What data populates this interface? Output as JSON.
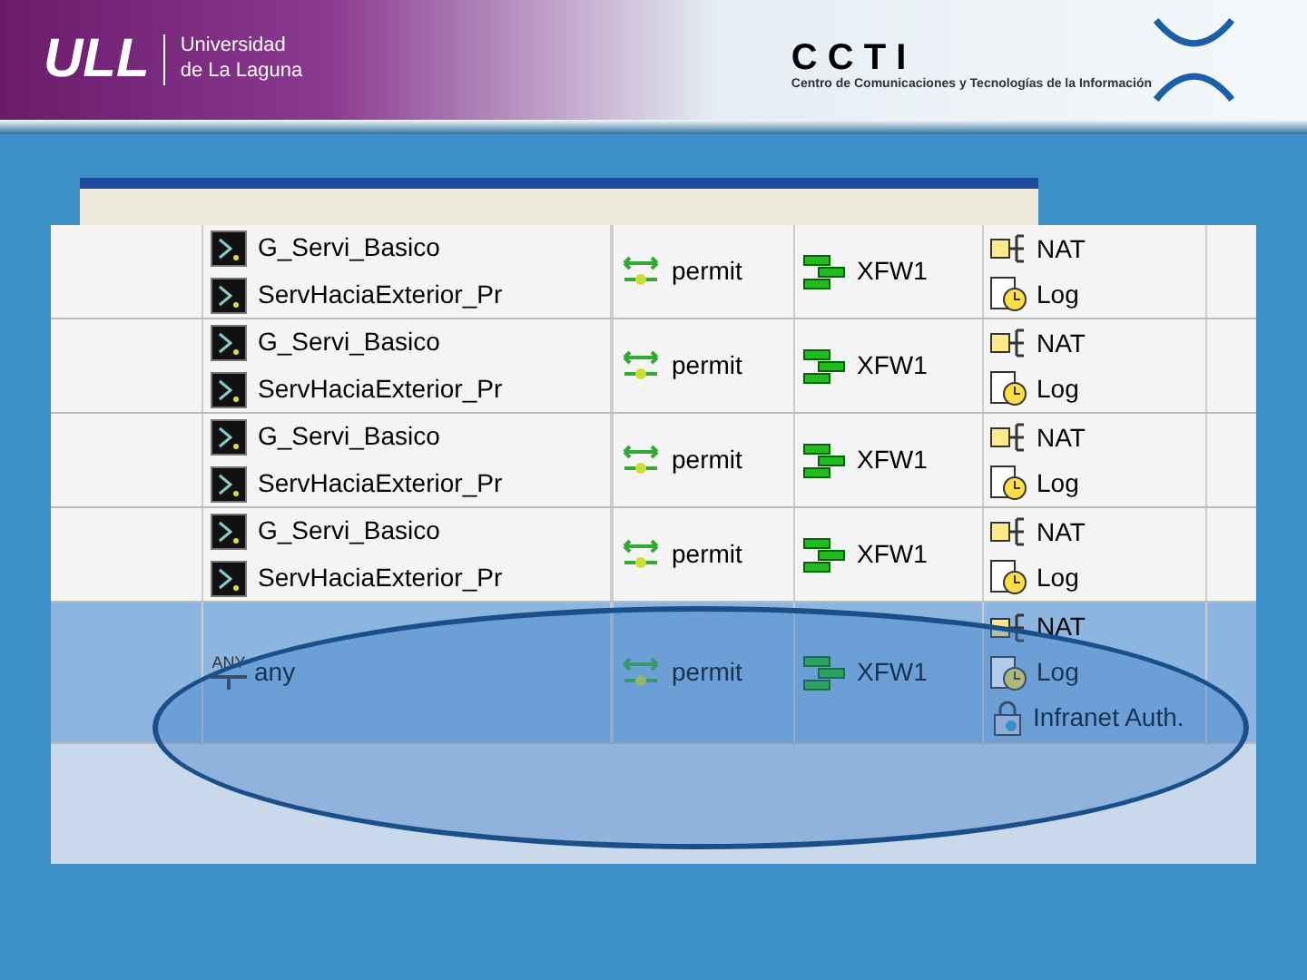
{
  "banner": {
    "logo": "ULL",
    "university": "Universidad de La Laguna",
    "center_logo": "C C T I",
    "center_name": "Centro de Comunicaciones y Tecnologías de la Información"
  },
  "rules": [
    {
      "sources": [
        "G_Servi_Basico",
        "ServHaciaExterior_Pr"
      ],
      "action": "permit",
      "target": "XFW1",
      "options": [
        {
          "kind": "nat",
          "label": "NAT"
        },
        {
          "kind": "log",
          "label": "Log"
        }
      ],
      "highlighted": false
    },
    {
      "sources": [
        "G_Servi_Basico",
        "ServHaciaExterior_Pr"
      ],
      "action": "permit",
      "target": "XFW1",
      "options": [
        {
          "kind": "nat",
          "label": "NAT"
        },
        {
          "kind": "log",
          "label": "Log"
        }
      ],
      "highlighted": false
    },
    {
      "sources": [
        "G_Servi_Basico",
        "ServHaciaExterior_Pr"
      ],
      "action": "permit",
      "target": "XFW1",
      "options": [
        {
          "kind": "nat",
          "label": "NAT"
        },
        {
          "kind": "log",
          "label": "Log"
        }
      ],
      "highlighted": false
    },
    {
      "sources": [
        "G_Servi_Basico",
        "ServHaciaExterior_Pr"
      ],
      "action": "permit",
      "target": "XFW1",
      "options": [
        {
          "kind": "nat",
          "label": "NAT"
        },
        {
          "kind": "log",
          "label": "Log"
        }
      ],
      "highlighted": false
    },
    {
      "any_source": {
        "badge": "ANY",
        "label": "any"
      },
      "action": "permit",
      "target": "XFW1",
      "options": [
        {
          "kind": "nat",
          "label": "NAT"
        },
        {
          "kind": "log",
          "label": "Log"
        },
        {
          "kind": "auth",
          "label": "Infranet Auth."
        }
      ],
      "highlighted": true
    }
  ]
}
